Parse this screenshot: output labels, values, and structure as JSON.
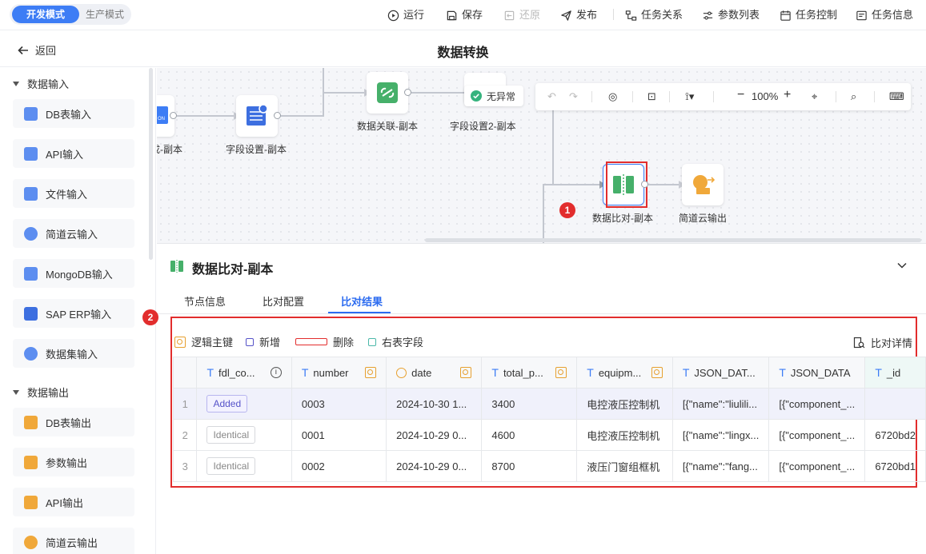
{
  "topbar": {
    "modes": [
      "开发模式",
      "生产模式"
    ],
    "actions": {
      "run": "运行",
      "save": "保存",
      "restore": "还原",
      "publish": "发布",
      "task_relation": "任务关系",
      "param_list": "参数列表",
      "task_control": "任务控制",
      "task_info": "任务信息"
    }
  },
  "subhead": {
    "back": "返回",
    "title": "数据转换"
  },
  "sidebar": {
    "groups": [
      "数据输入",
      "数据输出"
    ],
    "input_items": [
      "DB表输入",
      "API输入",
      "文件输入",
      "简道云输入",
      "MongoDB输入",
      "SAP ERP输入",
      "数据集输入"
    ],
    "output_items": [
      "DB表输出",
      "参数输出",
      "API输出",
      "简道云输出"
    ]
  },
  "canvas": {
    "nodes": {
      "partial_left": "成-副本",
      "field_setting": "字段设置-副本",
      "data_join": "数据关联-副本",
      "field_setting2": "字段设置2-副本",
      "data_compare": "数据比对-副本",
      "jdy_output": "简道云输出"
    },
    "status": "无异常",
    "zoom": "100%",
    "badges": [
      "1",
      "2"
    ]
  },
  "panel": {
    "title": "数据比对-副本",
    "tabs": [
      "节点信息",
      "比对配置",
      "比对结果"
    ],
    "active_tab": "比对结果",
    "legend": {
      "logic_key": "逻辑主键",
      "added": "新增",
      "deleted": "删除",
      "right_field": "右表字段"
    },
    "compare_detail": "比对详情",
    "table": {
      "columns": [
        "fdl_co...",
        "number",
        "date",
        "total_p...",
        "equipm...",
        "JSON_DAT...",
        "JSON_DATA",
        "_id"
      ],
      "rows": [
        {
          "n": "1",
          "status": "Added",
          "number": "0003",
          "date": "2024-10-30 1...",
          "total": "3400",
          "equip": "电控液压控制机",
          "json1": "[{\"name\":\"liulili...",
          "json2": "[{\"component_...",
          "id": ""
        },
        {
          "n": "2",
          "status": "Identical",
          "number": "0001",
          "date": "2024-10-29 0...",
          "total": "4600",
          "equip": "电控液压控制机",
          "json1": "[{\"name\":\"lingx...",
          "json2": "[{\"component_...",
          "id": "6720bd2"
        },
        {
          "n": "3",
          "status": "Identical",
          "number": "0002",
          "date": "2024-10-29 0...",
          "total": "8700",
          "equip": "液压门窗组框机",
          "json1": "[{\"name\":\"fang...",
          "json2": "[{\"component_...",
          "id": "6720bd1"
        }
      ]
    }
  },
  "colors": {
    "accent": "#3d7df5",
    "highlight": "#e22d2d",
    "added": "#5552c8",
    "key": "#e7a02f"
  }
}
